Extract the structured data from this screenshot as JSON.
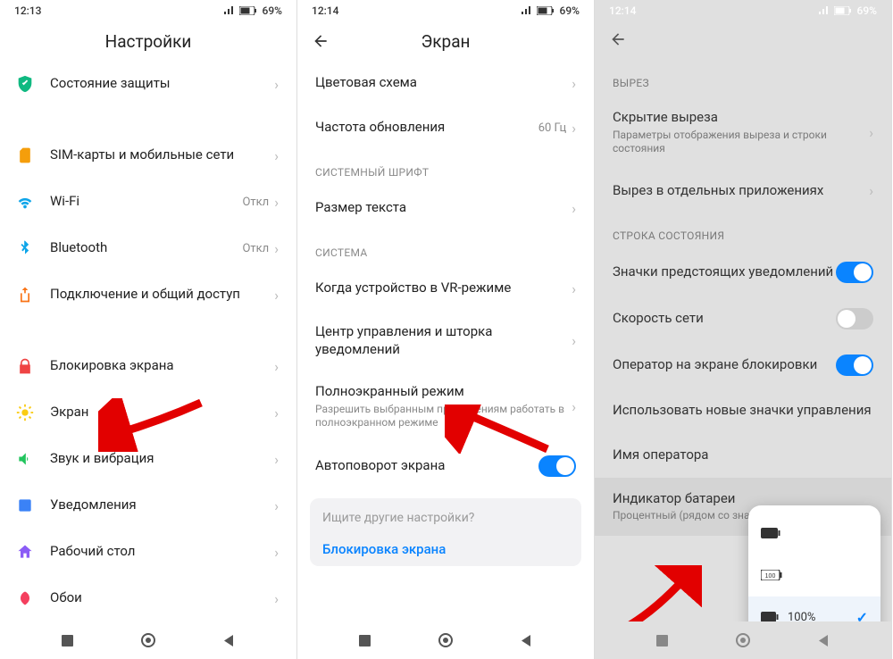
{
  "panel1": {
    "status": {
      "time": "12:13",
      "battery": "69%"
    },
    "title": "Настройки",
    "items": [
      {
        "label": "Состояние защиты",
        "value": ""
      },
      {
        "label": "SIM-карты и мобильные сети",
        "value": ""
      },
      {
        "label": "Wi-Fi",
        "value": "Откл"
      },
      {
        "label": "Bluetooth",
        "value": "Откл"
      },
      {
        "label": "Подключение и общий доступ",
        "value": ""
      },
      {
        "label": "Блокировка экрана",
        "value": ""
      },
      {
        "label": "Экран",
        "value": ""
      },
      {
        "label": "Звук и вибрация",
        "value": ""
      },
      {
        "label": "Уведомления",
        "value": ""
      },
      {
        "label": "Рабочий стол",
        "value": ""
      },
      {
        "label": "Обои",
        "value": ""
      }
    ]
  },
  "panel2": {
    "status": {
      "time": "12:14",
      "battery": "69%"
    },
    "title": "Экран",
    "items": [
      {
        "label": "Цветовая схема",
        "value": ""
      },
      {
        "label": "Частота обновления",
        "value": "60 Гц"
      }
    ],
    "section_font": "СИСТЕМНЫЙ ШРИФТ",
    "item_font": {
      "label": "Размер текста"
    },
    "section_system": "СИСТЕМА",
    "items_sys": [
      {
        "label": "Когда устройство в VR-режиме"
      },
      {
        "label": "Центр управления и шторка уведомлений"
      },
      {
        "label": "Полноэкранный режим",
        "sub": "Разрешить выбранным приложениям работать в полноэкранном режиме"
      }
    ],
    "item_autorotate": {
      "label": "Автоповорот экрана"
    },
    "search": {
      "placeholder": "Ищите другие настройки?",
      "link": "Блокировка экрана"
    }
  },
  "panel3": {
    "status": {
      "time": "12:14",
      "battery": "69%"
    },
    "section_cutout": "ВЫРЕЗ",
    "item_hide": {
      "label": "Скрытие выреза",
      "sub": "Параметры отображения выреза и строки состояния"
    },
    "item_apps": {
      "label": "Вырез в отдельных приложениях"
    },
    "section_status": "СТРОКА СОСТОЯНИЯ",
    "toggles": [
      {
        "label": "Значки предстоящих уведомлений",
        "on": true
      },
      {
        "label": "Скорость сети",
        "on": false
      },
      {
        "label": "Оператор на экране блокировки",
        "on": true
      },
      {
        "label": "Использовать новые значки управления"
      }
    ],
    "item_carrier": {
      "label": "Имя оператора"
    },
    "item_battery": {
      "label": "Индикатор батареи",
      "sub": "Процентный (рядом со значком)"
    },
    "popup": {
      "options": [
        {
          "text": ""
        },
        {
          "text": ""
        },
        {
          "text": "100%",
          "selected": true
        }
      ]
    }
  }
}
